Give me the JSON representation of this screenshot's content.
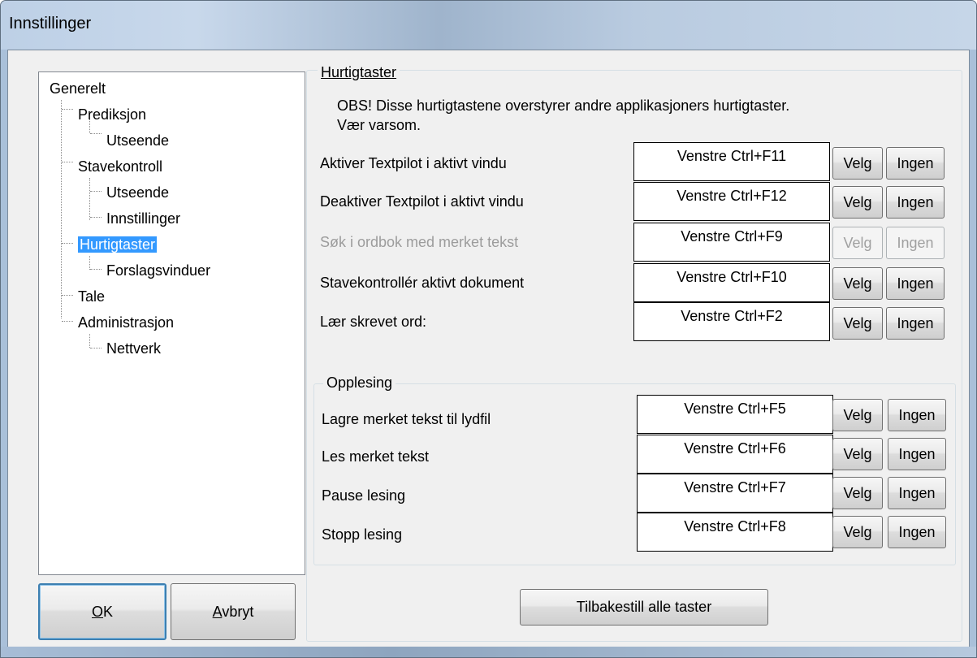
{
  "window": {
    "title": "Innstillinger"
  },
  "tree": [
    {
      "label": "Generelt",
      "level": 0,
      "selected": false
    },
    {
      "label": "Prediksjon",
      "level": 1,
      "selected": false
    },
    {
      "label": "Utseende",
      "level": 2,
      "selected": false
    },
    {
      "label": "Stavekontroll",
      "level": 1,
      "selected": false
    },
    {
      "label": "Utseende",
      "level": 2,
      "selected": false
    },
    {
      "label": "Innstillinger",
      "level": 2,
      "selected": false
    },
    {
      "label": "Hurtigtaster",
      "level": 1,
      "selected": true
    },
    {
      "label": "Forslagsvinduer",
      "level": 2,
      "selected": false
    },
    {
      "label": "Tale",
      "level": 1,
      "selected": false
    },
    {
      "label": "Administrasjon",
      "level": 1,
      "selected": false
    },
    {
      "label": "Nettverk",
      "level": 2,
      "selected": false
    }
  ],
  "footer": {
    "ok_label": "OK",
    "ok_mnemonic": "O",
    "ok_rest": "K",
    "cancel_label": "Avbryt",
    "cancel_mnemonic": "A",
    "cancel_rest": "vbryt"
  },
  "hotkeys": {
    "title": "Hurtigtaster",
    "notice_line1": "OBS! Disse hurtigtastene overstyrer andre applikasjoners hurtigtaster.",
    "notice_line2": "Vær varsom.",
    "rows": [
      {
        "label": "Aktiver Textpilot i aktivt vindu",
        "key": "Venstre Ctrl+F11",
        "select": "Velg",
        "none": "Ingen",
        "enabled": true
      },
      {
        "label": "Deaktiver Textpilot i aktivt vindu",
        "key": "Venstre Ctrl+F12",
        "select": "Velg",
        "none": "Ingen",
        "enabled": true
      },
      {
        "label": "Søk i ordbok med merket tekst",
        "key": "Venstre Ctrl+F9",
        "select": "Velg",
        "none": "Ingen",
        "enabled": false
      },
      {
        "label": "Stavekontrollér aktivt dokument",
        "key": "Venstre Ctrl+F10",
        "select": "Velg",
        "none": "Ingen",
        "enabled": true
      },
      {
        "label": "Lær skrevet ord:",
        "key": "Venstre Ctrl+F2",
        "select": "Velg",
        "none": "Ingen",
        "enabled": true
      }
    ]
  },
  "reading": {
    "title": "Opplesing",
    "rows": [
      {
        "label": "Lagre merket tekst til lydfil",
        "key": "Venstre Ctrl+F5",
        "select": "Velg",
        "none": "Ingen",
        "enabled": true
      },
      {
        "label": "Les merket tekst",
        "key": "Venstre Ctrl+F6",
        "select": "Velg",
        "none": "Ingen",
        "enabled": true
      },
      {
        "label": "Pause lesing",
        "key": "Venstre Ctrl+F7",
        "select": "Velg",
        "none": "Ingen",
        "enabled": true
      },
      {
        "label": "Stopp lesing",
        "key": "Venstre Ctrl+F8",
        "select": "Velg",
        "none": "Ingen",
        "enabled": true
      }
    ]
  },
  "reset_label": "Tilbakestill alle taster"
}
